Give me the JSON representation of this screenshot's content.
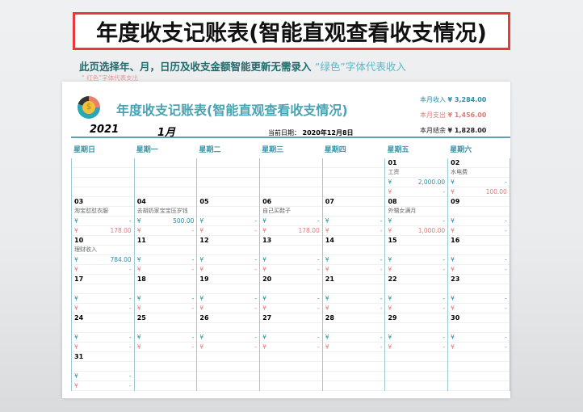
{
  "banner": "年度收支记账表(智能直观查看收支情况)",
  "subtitle": {
    "a": "此页选择年、月，日历及收支金额智能更新无需录入",
    "g": "“绿色”字体代表收入",
    "r": "“ 红色”字体代表支出"
  },
  "sheet": {
    "title": "年度收支记账表(智能直观查看收支情况)",
    "year": "2021",
    "month": "1月",
    "current_date_label": "当前日期：",
    "current_date": "2020年12月8日",
    "income_label": "本月收入",
    "income": "¥ 3,284.00",
    "expense_label": "本月支出",
    "expense": "¥ 1,456.00",
    "balance_label": "本月结余",
    "balance": "¥ 1,828.00"
  },
  "colors": {
    "income": "#2a8fa6",
    "expense": "#e07b7b"
  },
  "weekdays": [
    "星期日",
    "星期一",
    "星期二",
    "星期三",
    "星期四",
    "星期五",
    "星期六"
  ],
  "currency": "¥",
  "weeks": [
    [
      null,
      null,
      null,
      null,
      null,
      {
        "day": "01",
        "note": "工资",
        "income": "2,000.00",
        "expense": "-"
      },
      {
        "day": "02",
        "note": "水电费",
        "income": "-",
        "expense": "100.00"
      }
    ],
    [
      {
        "day": "03",
        "note": "淘宝怼怼衣服",
        "income": "-",
        "expense": "178.00"
      },
      {
        "day": "04",
        "note": "去胡奶家宝宝压岁钱",
        "income": "500.00",
        "expense": "-"
      },
      {
        "day": "05",
        "note": "",
        "income": "-",
        "expense": "-"
      },
      {
        "day": "06",
        "note": "自己买鞋子",
        "income": "-",
        "expense": "178.00"
      },
      {
        "day": "07",
        "note": "",
        "income": "-",
        "expense": "-"
      },
      {
        "day": "08",
        "note": "外甥女满月",
        "income": "-",
        "expense": "1,000.00"
      },
      {
        "day": "09",
        "note": "",
        "income": "-",
        "expense": "-"
      }
    ],
    [
      {
        "day": "10",
        "note": "理财收入",
        "income": "784.00",
        "expense": "-"
      },
      {
        "day": "11",
        "note": "",
        "income": "-",
        "expense": "-"
      },
      {
        "day": "12",
        "note": "",
        "income": "-",
        "expense": "-"
      },
      {
        "day": "13",
        "note": "",
        "income": "-",
        "expense": "-"
      },
      {
        "day": "14",
        "note": "",
        "income": "-",
        "expense": "-"
      },
      {
        "day": "15",
        "note": "",
        "income": "-",
        "expense": "-"
      },
      {
        "day": "16",
        "note": "",
        "income": "-",
        "expense": "-"
      }
    ],
    [
      {
        "day": "17",
        "note": "",
        "income": "-",
        "expense": "-"
      },
      {
        "day": "18",
        "note": "",
        "income": "-",
        "expense": "-"
      },
      {
        "day": "19",
        "note": "",
        "income": "-",
        "expense": "-"
      },
      {
        "day": "20",
        "note": "",
        "income": "-",
        "expense": "-"
      },
      {
        "day": "21",
        "note": "",
        "income": "-",
        "expense": "-"
      },
      {
        "day": "22",
        "note": "",
        "income": "-",
        "expense": "-"
      },
      {
        "day": "23",
        "note": "",
        "income": "-",
        "expense": "-"
      }
    ],
    [
      {
        "day": "24",
        "note": "",
        "income": "-",
        "expense": "-"
      },
      {
        "day": "25",
        "note": "",
        "income": "-",
        "expense": "-"
      },
      {
        "day": "26",
        "note": "",
        "income": "-",
        "expense": "-"
      },
      {
        "day": "27",
        "note": "",
        "income": "-",
        "expense": "-"
      },
      {
        "day": "28",
        "note": "",
        "income": "-",
        "expense": "-"
      },
      {
        "day": "29",
        "note": "",
        "income": "-",
        "expense": "-"
      },
      {
        "day": "30",
        "note": "",
        "income": "-",
        "expense": "-"
      }
    ],
    [
      {
        "day": "31",
        "note": "",
        "income": "-",
        "expense": "-"
      },
      null,
      null,
      null,
      null,
      null,
      null
    ]
  ]
}
